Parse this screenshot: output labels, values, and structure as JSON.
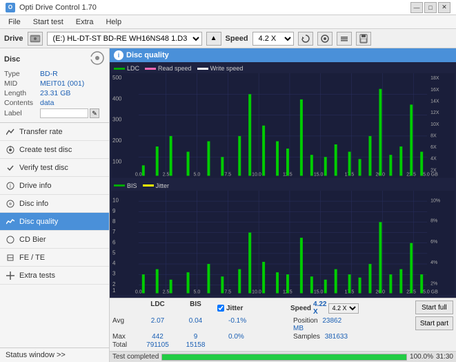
{
  "window": {
    "title": "Opti Drive Control 1.70",
    "controls": {
      "minimize": "—",
      "maximize": "□",
      "close": "✕"
    }
  },
  "menu": {
    "items": [
      "File",
      "Start test",
      "Extra",
      "Help"
    ]
  },
  "drive_bar": {
    "label": "Drive",
    "drive_value": "(E:)  HL-DT-ST BD-RE  WH16NS48 1.D3",
    "speed_label": "Speed",
    "speed_value": "4.2 X"
  },
  "disc": {
    "title": "Disc",
    "type_label": "Type",
    "type_value": "BD-R",
    "mid_label": "MID",
    "mid_value": "MEIT01 (001)",
    "length_label": "Length",
    "length_value": "23.31 GB",
    "contents_label": "Contents",
    "contents_value": "data",
    "label_label": "Label",
    "label_value": ""
  },
  "nav": {
    "items": [
      {
        "id": "transfer-rate",
        "label": "Transfer rate",
        "icon": "chart"
      },
      {
        "id": "create-test-disc",
        "label": "Create test disc",
        "icon": "disc"
      },
      {
        "id": "verify-test-disc",
        "label": "Verify test disc",
        "icon": "check"
      },
      {
        "id": "drive-info",
        "label": "Drive info",
        "icon": "info"
      },
      {
        "id": "disc-info",
        "label": "Disc info",
        "icon": "disc-info"
      },
      {
        "id": "disc-quality",
        "label": "Disc quality",
        "icon": "quality",
        "active": true
      },
      {
        "id": "cd-bier",
        "label": "CD Bier",
        "icon": "cd"
      },
      {
        "id": "fe-te",
        "label": "FE / TE",
        "icon": "fe"
      },
      {
        "id": "extra-tests",
        "label": "Extra tests",
        "icon": "extra"
      }
    ]
  },
  "status_window": {
    "label": "Status window >> "
  },
  "disc_quality": {
    "title": "Disc quality",
    "chart1": {
      "legend": [
        {
          "color": "#00aa00",
          "label": "LDC"
        },
        {
          "color": "#ff69b4",
          "label": "Read speed"
        },
        {
          "color": "#ffffff",
          "label": "Write speed"
        }
      ],
      "y_max": 500,
      "y_labels": [
        "500",
        "400",
        "300",
        "200",
        "100",
        "0"
      ],
      "y_right_labels": [
        "18X",
        "16X",
        "14X",
        "12X",
        "10X",
        "8X",
        "6X",
        "4X",
        "2X"
      ],
      "x_labels": [
        "0.0",
        "2.5",
        "5.0",
        "7.5",
        "10.0",
        "12.5",
        "15.0",
        "17.5",
        "20.0",
        "22.5",
        "25.0 GB"
      ]
    },
    "chart2": {
      "legend": [
        {
          "color": "#00aa00",
          "label": "BIS"
        },
        {
          "color": "#ffff00",
          "label": "Jitter"
        }
      ],
      "y_max": 10,
      "y_labels": [
        "10",
        "9",
        "8",
        "7",
        "6",
        "5",
        "4",
        "3",
        "2",
        "1"
      ],
      "y_right_labels": [
        "10%",
        "8%",
        "6%",
        "4%",
        "2%"
      ],
      "x_labels": [
        "0.0",
        "2.5",
        "5.0",
        "7.5",
        "10.0",
        "12.5",
        "15.0",
        "17.5",
        "20.0",
        "22.5",
        "25.0 GB"
      ]
    },
    "stats": {
      "headers": [
        "",
        "LDC",
        "BIS",
        "",
        "Jitter",
        "Speed",
        ""
      ],
      "avg_label": "Avg",
      "avg_ldc": "2.07",
      "avg_bis": "0.04",
      "avg_jitter": "-0.1%",
      "max_label": "Max",
      "max_ldc": "442",
      "max_bis": "9",
      "max_jitter": "0.0%",
      "total_label": "Total",
      "total_ldc": "791105",
      "total_bis": "15158",
      "speed_label": "Speed",
      "speed_value": "4.22 X",
      "speed_select": "4.2 X",
      "position_label": "Position",
      "position_value": "23862 MB",
      "samples_label": "Samples",
      "samples_value": "381633",
      "jitter_checked": true,
      "start_full_label": "Start full",
      "start_part_label": "Start part"
    }
  },
  "progress": {
    "status": "Test completed",
    "percent": 100,
    "percent_label": "100.0%",
    "time": "31:30"
  }
}
